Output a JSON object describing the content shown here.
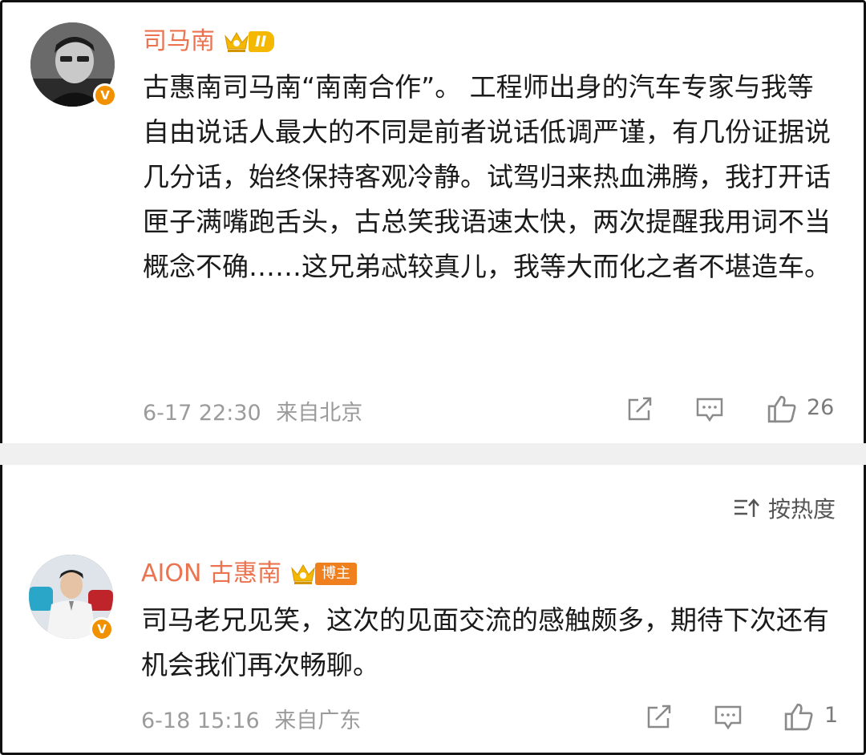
{
  "comments": [
    {
      "username": "司马南",
      "level_badge": "II",
      "verified_mark": "V",
      "text": "古惠南司马南“南南合作”。 工程师出身的汽车专家与我等自由说话人最大的不同是前者说话低调严谨，有几份证据说几分话，始终保持客观冷静。试驾归来热血沸腾，我打开话匣子满嘴跑舌头，古总笑我语速太快，两次提醒我用词不当概念不确……这兄弟忒较真儿，我等大而化之者不堪造车。",
      "time": "6-17 22:30",
      "location": "来自北京",
      "likes": "26"
    },
    {
      "username": "AION 古惠南",
      "role_badge": "博主",
      "verified_mark": "V",
      "text": "司马老兄见笑，这次的见面交流的感触颇多，期待下次还有机会我们再次畅聊。",
      "time": "6-18 15:16",
      "location": "来自广东",
      "likes": "1"
    }
  ],
  "sort": {
    "label": "按热度"
  },
  "icons": {
    "repost": "repost-icon",
    "comment": "comment-icon",
    "like": "thumbs-up-icon",
    "sort": "sort-icon",
    "crown": "crown-icon"
  },
  "colors": {
    "username": "#eb7350",
    "meta": "#9b9b9b",
    "verified": "#f29100",
    "divider": "#f0f0f0"
  }
}
